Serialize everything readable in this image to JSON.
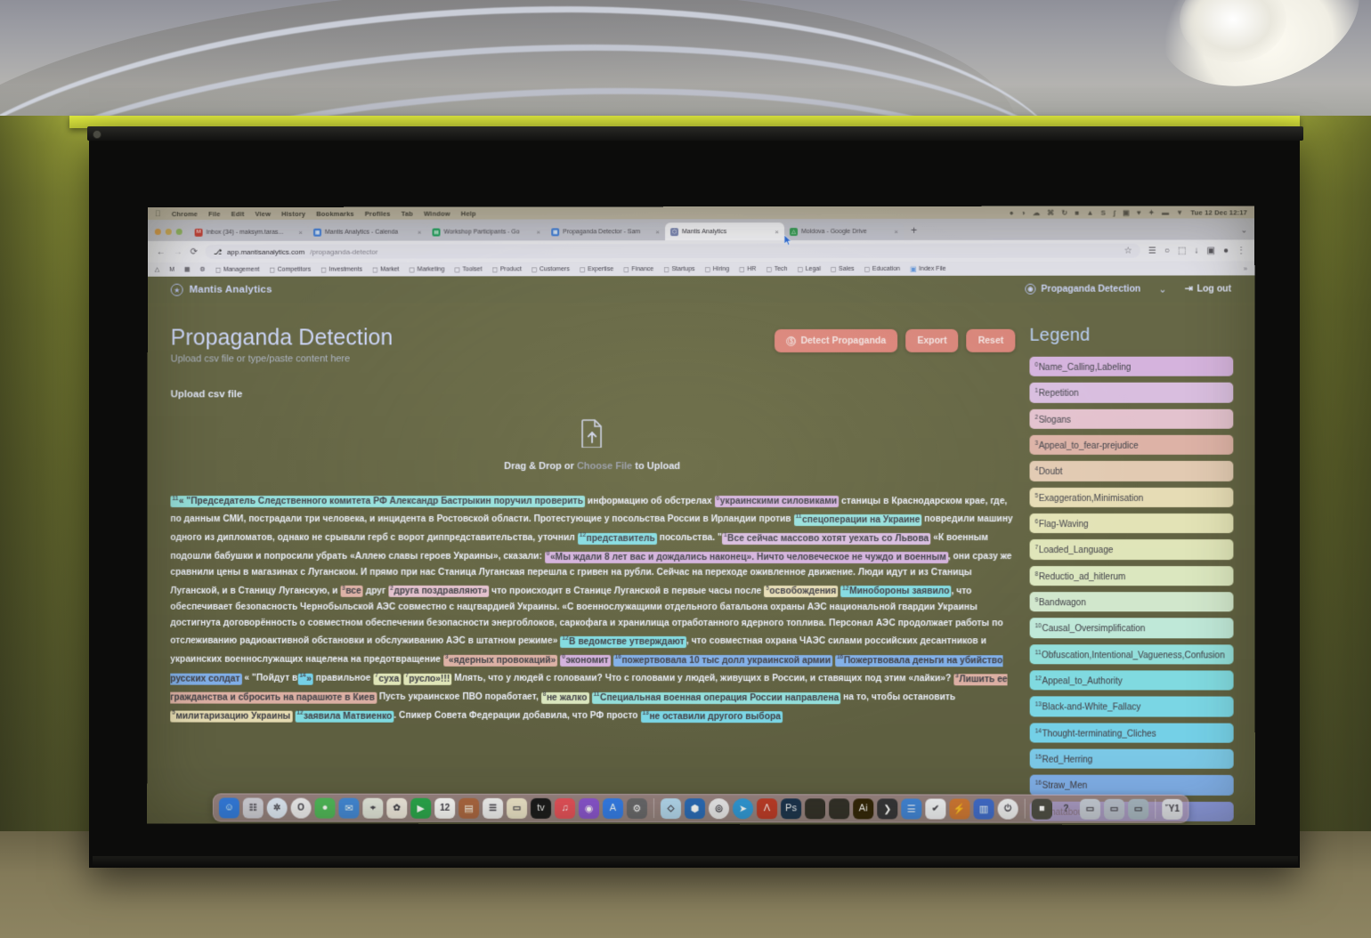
{
  "os": {
    "menubar": {
      "apple": "",
      "items": [
        "Chrome",
        "File",
        "Edit",
        "View",
        "History",
        "Bookmarks",
        "Profiles",
        "Tab",
        "Window",
        "Help"
      ],
      "right_icons": [
        "●",
        "◑",
        "☁",
        "⌘",
        "↻",
        "■",
        "▲",
        "S",
        "ʃ",
        "▣",
        "♥",
        "✦",
        "▬",
        "▼",
        "☳",
        "◆"
      ],
      "clock": "Tue 12 Dec  12:17"
    },
    "dock": {
      "items": [
        {
          "name": "finder-icon",
          "glyph": "☺",
          "color": "#3a8ee6",
          "round": false
        },
        {
          "name": "launchpad-icon",
          "glyph": "☷",
          "color": "#d8d8e0",
          "round": false
        },
        {
          "name": "safari-icon",
          "glyph": "✲",
          "color": "#e6f0fb",
          "round": true
        },
        {
          "name": "opera-icon",
          "glyph": "O",
          "color": "#f3f3f5",
          "round": true
        },
        {
          "name": "messages-icon",
          "glyph": "●",
          "color": "#5ec46a",
          "round": false
        },
        {
          "name": "mail-icon",
          "glyph": "✉",
          "color": "#4e9ae0",
          "round": false
        },
        {
          "name": "maps-icon",
          "glyph": "⌖",
          "color": "#e9ece4",
          "round": false
        },
        {
          "name": "photos-icon",
          "glyph": "✿",
          "color": "#f4efe6",
          "round": false
        },
        {
          "name": "facetime-icon",
          "glyph": "▶",
          "color": "#2fb45a",
          "round": false
        },
        {
          "name": "calendar-icon",
          "glyph": "12",
          "color": "#fdfdfd",
          "round": false
        },
        {
          "name": "contacts-icon",
          "glyph": "▤",
          "color": "#b87a4d",
          "round": false
        },
        {
          "name": "reminders-icon",
          "glyph": "☰",
          "color": "#f6f6f8",
          "round": false
        },
        {
          "name": "notes-icon",
          "glyph": "▭",
          "color": "#f2ebd3",
          "round": false
        },
        {
          "name": "appletv-icon",
          "glyph": "tv",
          "color": "#1c1c1e",
          "round": false
        },
        {
          "name": "music-icon",
          "glyph": "♫",
          "color": "#ec5f6a",
          "round": false
        },
        {
          "name": "podcasts-icon",
          "glyph": "◉",
          "color": "#9a63d8",
          "round": false
        },
        {
          "name": "appstore-icon",
          "glyph": "A",
          "color": "#3b8ff0",
          "round": false
        },
        {
          "name": "system-settings-icon",
          "glyph": "⚙",
          "color": "#7b7b80",
          "round": false
        },
        {
          "name": "sep",
          "glyph": "",
          "color": "",
          "round": false
        },
        {
          "name": "dropbox-icon",
          "glyph": "◇",
          "color": "#bfe0f5",
          "round": false
        },
        {
          "name": "vscode-icon",
          "glyph": "⬢",
          "color": "#2f7fc4",
          "round": false
        },
        {
          "name": "chrome-icon",
          "glyph": "◎",
          "color": "#f0f0f2",
          "round": true
        },
        {
          "name": "telegram-icon",
          "glyph": "➤",
          "color": "#36a8e0",
          "round": true
        },
        {
          "name": "acrobat-icon",
          "glyph": "Λ",
          "color": "#c8442e",
          "round": false
        },
        {
          "name": "photoshop-icon",
          "glyph": "Ps",
          "color": "#1d3b5c",
          "round": false
        },
        {
          "name": "app-dark-1-icon",
          "glyph": "",
          "color": "#3a372f",
          "round": false
        },
        {
          "name": "app-dark-2-icon",
          "glyph": "",
          "color": "#3a372f",
          "round": false
        },
        {
          "name": "illustrator-icon",
          "glyph": "Ai",
          "color": "#3a2a06",
          "round": false
        },
        {
          "name": "terminal-icon",
          "glyph": "❯",
          "color": "#3d3d42",
          "round": false
        },
        {
          "name": "files-icon",
          "glyph": "☰",
          "color": "#4c96e0",
          "round": false
        },
        {
          "name": "todo-icon",
          "glyph": "✔",
          "color": "#f5f7fa",
          "round": false
        },
        {
          "name": "bolt-icon",
          "glyph": "⚡",
          "color": "#d88a3c",
          "round": false
        },
        {
          "name": "dictionary-icon",
          "glyph": "▥",
          "color": "#4b80d6",
          "round": false
        },
        {
          "name": "power-icon",
          "glyph": "⏻",
          "color": "#f3f4f7",
          "round": true
        },
        {
          "name": "sep2",
          "glyph": "",
          "color": "",
          "round": false
        },
        {
          "name": "screenshot-icon",
          "glyph": "■",
          "color": "#5a5a52",
          "round": false
        },
        {
          "name": "help-icon",
          "glyph": "?",
          "color": "transparent",
          "round": false
        },
        {
          "name": "display-1-icon",
          "glyph": "▭",
          "color": "#cfd4de",
          "round": false
        },
        {
          "name": "display-2-icon",
          "glyph": "▭",
          "color": "#c2c8d4",
          "round": false
        },
        {
          "name": "display-3-icon",
          "glyph": "▭",
          "color": "#b4c2cc",
          "round": false
        },
        {
          "name": "sep3",
          "glyph": "",
          "color": "",
          "round": false
        },
        {
          "name": "trash-icon",
          "glyph": "Ὕ1",
          "color": "#e2e4ea",
          "round": false
        }
      ]
    }
  },
  "browser": {
    "tabs": [
      {
        "title": "Inbox (34) - maksym.taras...",
        "favicon": "M",
        "favicon_color": "#c4463c",
        "active": false
      },
      {
        "title": "Mantis Analytics - Calenda",
        "favicon": "▦",
        "favicon_color": "#4a86d8",
        "active": false
      },
      {
        "title": "Workshop Participants - Go",
        "favicon": "▤",
        "favicon_color": "#27a465",
        "active": false
      },
      {
        "title": "Propaganda Detector - Sam",
        "favicon": "▦",
        "favicon_color": "#4a86d8",
        "active": false
      },
      {
        "title": "Mantis Analytics",
        "favicon": "⬡",
        "favicon_color": "#7d88b4",
        "active": true
      },
      {
        "title": "Moldova - Google Drive",
        "favicon": "△",
        "favicon_color": "#3a9e5a",
        "active": false
      }
    ],
    "new_tab_label": "+",
    "tabstrip_overflow": "⌄",
    "nav": {
      "back": "←",
      "forward": "→",
      "reload": "⟳"
    },
    "address": {
      "lock": "⎇",
      "host": "app.mantisanalytics.com",
      "path": "/propaganda-detector"
    },
    "omni_right": [
      "☆",
      "☰",
      "○",
      "⬚",
      "↓",
      "▣",
      "●",
      "⋮"
    ],
    "bookmarks_leading": [
      "△",
      "M",
      "▦",
      "⚙"
    ],
    "bookmarks": [
      "Management",
      "Competitors",
      "Investments",
      "Market",
      "Marketing",
      "Toolset",
      "Product",
      "Customers",
      "Expertise",
      "Finance",
      "Startups",
      "Hiring",
      "HR",
      "Tech",
      "Legal",
      "Sales",
      "Education",
      "Index File"
    ],
    "bookmarks_overflow": "»"
  },
  "app": {
    "brand": "Mantis Analytics",
    "module": "Propaganda Detection",
    "module_chevron": "⌄",
    "logout": "Log out",
    "logout_icon": "⇥",
    "title": "Propaganda Detection",
    "subtitle": "Upload csv file or type/paste content here",
    "buttons": {
      "detect": "Detect Propaganda",
      "export": "Export",
      "reset": "Reset"
    },
    "upload_label": "Upload csv file",
    "dropzone": {
      "prefix": "Drag & Drop or ",
      "link": "Choose File",
      "suffix": " to Upload"
    },
    "document": {
      "segments": [
        {
          "t": "« \"Председатель Следственного комитета РФ Александр Бастрыкин поручил проверить",
          "hl": 11,
          "sup": "11"
        },
        {
          "t": " информацию об обстрелах ",
          "hl": null
        },
        {
          "t": "украинскими силовиками",
          "hl": 0,
          "sup": "0"
        },
        {
          "t": " станицы в Краснодарском крае, где, по данным СМИ, пострадали три человека, и инцидента в Ростовской области. Протестующие у посольства России в Ирландии против ",
          "hl": null
        },
        {
          "t": "спецоперации на Украине",
          "hl": 11,
          "sup": "11"
        },
        {
          "t": " повредили машину одного из дипломатов, однако не срывали герб с ворот диппредставительства, уточнил ",
          "hl": null
        },
        {
          "t": "представитель",
          "hl": 12,
          "sup": "12"
        },
        {
          "t": " посольства. \"",
          "hl": null
        },
        {
          "t": "Все сейчас массово хотят уехать со Львова",
          "hl": 1,
          "sup": "1"
        },
        {
          "t": " «К военным подошли бабушки и попросили убрать «Аллею славы героев Украины», сказали: ",
          "hl": null
        },
        {
          "t": "«Мы ждали 8 лет вас и дождались наконец». Ничто человеческое не чуждо и военным",
          "hl": 0,
          "sup": "0"
        },
        {
          "t": ", они сразу же сравнили цены в магазинах с Луганском. И прямо при нас Станица Луганская перешла с гривен на рубли. Сейчас на переходе оживленное движение. Люди идут и из Станицы Луганской, и в Станицу Луганскую, и ",
          "hl": null
        },
        {
          "t": "все",
          "hl": 3,
          "sup": "3"
        },
        {
          "t": " друг ",
          "hl": null
        },
        {
          "t": "друга поздравляют»",
          "hl": 2,
          "sup": "2"
        },
        {
          "t": " что происходит в Станице Луганской в первые часы после ",
          "hl": null
        },
        {
          "t": "освобождения",
          "hl": 5,
          "sup": "5"
        },
        {
          "t": " ",
          "hl": null
        },
        {
          "t": "Минобороны заявило",
          "hl": 12,
          "sup": "12"
        },
        {
          "t": ", что обеспечивает безопасность Чернобыльской АЭС совместно с нацгвардией Украины. «С военнослужащими отдельного батальона охраны АЭС национальной гвардии Украины достигнута договорённость о совместном обеспечении безопасности энергоблоков, саркофага и хранилища отработанного ядерного топлива. Персонал АЭС продолжает работы по отслеживанию радиоактивной обстановки и обслуживанию АЭС в штатном режиме» ",
          "hl": null
        },
        {
          "t": "В ведомстве утверждают",
          "hl": 12,
          "sup": "12"
        },
        {
          "t": ", что совместная охрана ЧАЭС силами российских десантников и украинских военнослужащих нацелена на предотвращение ",
          "hl": null
        },
        {
          "t": "«ядерных провокаций»",
          "hl": 3,
          "sup": "3"
        },
        {
          "t": " ",
          "hl": null
        },
        {
          "t": "экономит",
          "hl": 0,
          "sup": "0"
        },
        {
          "t": " ",
          "hl": null
        },
        {
          "t": "пожертвовала 10 тыс долл украинской армии",
          "hl": 16,
          "sup": "16"
        },
        {
          "t": " ",
          "hl": null
        },
        {
          "t": "Пожертвовала деньги на убийство русских солдат",
          "hl": 16,
          "sup": "16"
        },
        {
          "t": " « \"Пойдут в",
          "hl": null
        },
        {
          "t": "»",
          "hl": 14,
          "sup": "14"
        },
        {
          "t": " правильное ",
          "hl": null
        },
        {
          "t": "суха",
          "hl": 7,
          "sup": "7"
        },
        {
          "t": " ",
          "hl": null
        },
        {
          "t": "русло»!!!",
          "hl": 7,
          "sup": "7"
        },
        {
          "t": " Млять, что у людей с головами? Что с головами у людей, живущих в России, и ставящих под этим «лайки»? ",
          "hl": null
        },
        {
          "t": "Лишить ее гражданства и сбросить на парашюте в Киев",
          "hl": 3,
          "sup": "3"
        },
        {
          "t": " Пусть украинское ПВО поработает, ",
          "hl": null
        },
        {
          "t": "не жалко",
          "hl": 8,
          "sup": "8"
        },
        {
          "t": " ",
          "hl": null
        },
        {
          "t": "Специальная военная операция России направлена",
          "hl": 11,
          "sup": "11"
        },
        {
          "t": " на то, чтобы остановить ",
          "hl": null
        },
        {
          "t": "милитаризацию Украины",
          "hl": 5,
          "sup": "5"
        },
        {
          "t": " ",
          "hl": null
        },
        {
          "t": "заявила Матвиенко",
          "hl": 12,
          "sup": "12"
        },
        {
          "t": ". Спикер Совета Федерации добавила, что РФ просто ",
          "hl": null
        },
        {
          "t": "не оставили другого выбора",
          "hl": 13,
          "sup": "13"
        }
      ]
    },
    "legend": {
      "title": "Legend",
      "items": [
        {
          "index": "0",
          "label": "Name_Calling,Labeling",
          "color": "#d8b9e0"
        },
        {
          "index": "1",
          "label": "Repetition",
          "color": "#dcc3e2"
        },
        {
          "index": "2",
          "label": "Slogans",
          "color": "#e6c7d2"
        },
        {
          "index": "3",
          "label": "Appeal_to_fear-prejudice",
          "color": "#e0b9ae"
        },
        {
          "index": "4",
          "label": "Doubt",
          "color": "#e5cfb9"
        },
        {
          "index": "5",
          "label": "Exaggeration,Minimisation",
          "color": "#e9e0bc"
        },
        {
          "index": "6",
          "label": "Flag-Waving",
          "color": "#e6e6bd"
        },
        {
          "index": "7",
          "label": "Loaded_Language",
          "color": "#e3e8c0"
        },
        {
          "index": "8",
          "label": "Reductio_ad_hitlerum",
          "color": "#dfeac6"
        },
        {
          "index": "9",
          "label": "Bandwagon",
          "color": "#d6ead2"
        },
        {
          "index": "10",
          "label": "Causal_Oversimplification",
          "color": "#c6ebdd"
        },
        {
          "index": "11",
          "label": "Obfuscation,Intentional_Vagueness,Confusion",
          "color": "#9fe3df"
        },
        {
          "index": "12",
          "label": "Appeal_to_Authority",
          "color": "#8fdfe4"
        },
        {
          "index": "13",
          "label": "Black-and-White_Fallacy",
          "color": "#8adbe8"
        },
        {
          "index": "14",
          "label": "Thought-terminating_Cliches",
          "color": "#86d6ea"
        },
        {
          "index": "15",
          "label": "Red_Herring",
          "color": "#8ccfea"
        },
        {
          "index": "16",
          "label": "Straw_Men",
          "color": "#8fb8ea"
        },
        {
          "index": "17",
          "label": "Whataboutism",
          "color": "#9aa6e4"
        }
      ]
    }
  }
}
